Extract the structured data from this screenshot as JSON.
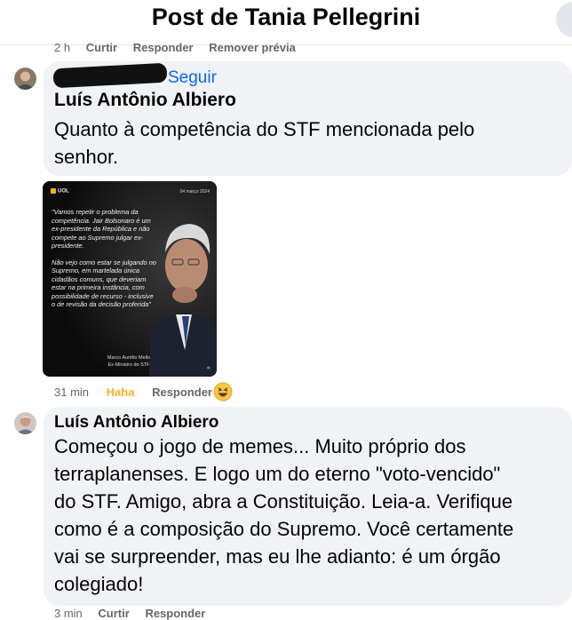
{
  "header": {
    "title": "Post de Tania Pellegrini"
  },
  "top_actions": {
    "time": "2 h",
    "like": "Curtir",
    "reply": "Responder",
    "remove_preview": "Remover prévia"
  },
  "comment1": {
    "follow_label": "Seguir",
    "author": "Luís Antônio Albiero",
    "text_line1": "Quanto à competência do STF mencionada pelo",
    "text_line2": "senhor."
  },
  "meme": {
    "logo": "UOL",
    "date": "04 março 2024",
    "quote_p1": "\"Vamos repetir o problema da competência. Jair Bolsonaro é um ex-presidente da República e não compete ao Supremo julgar ex-presidente.",
    "quote_p2": "Não vejo como estar se julgando no Supremo, em martelada única cidadãos comuns, que deveriam estar na primeira instância, com possibilidade de recurso - inclusive o de revisão da decisão proferida\"",
    "signature_name": "Marco Aurélio Mello",
    "signature_role": "Ex-Ministro do STF"
  },
  "meme_meta": {
    "time": "31 min",
    "reaction": "Haha",
    "reply": "Responder"
  },
  "comment2": {
    "author": "Luís Antônio Albiero",
    "lines": [
      "Começou o jogo de memes... Muito próprio dos",
      "terraplanenses. E logo um do eterno \"voto-vencido\"",
      "do STF. Amigo, abra a Constituição. Leia-a. Verifique",
      "como é a composição do Supremo. Você certamente",
      "vai se surpreender, mas eu lhe adianto: é um órgão",
      "colegiado!"
    ]
  },
  "comment2_meta": {
    "time": "3 min",
    "like": "Curtir",
    "reply": "Responder"
  },
  "colors": {
    "bubble": "#f0f2f5",
    "link": "#0866ff",
    "haha": "#f7b125",
    "meta": "#65676b"
  }
}
